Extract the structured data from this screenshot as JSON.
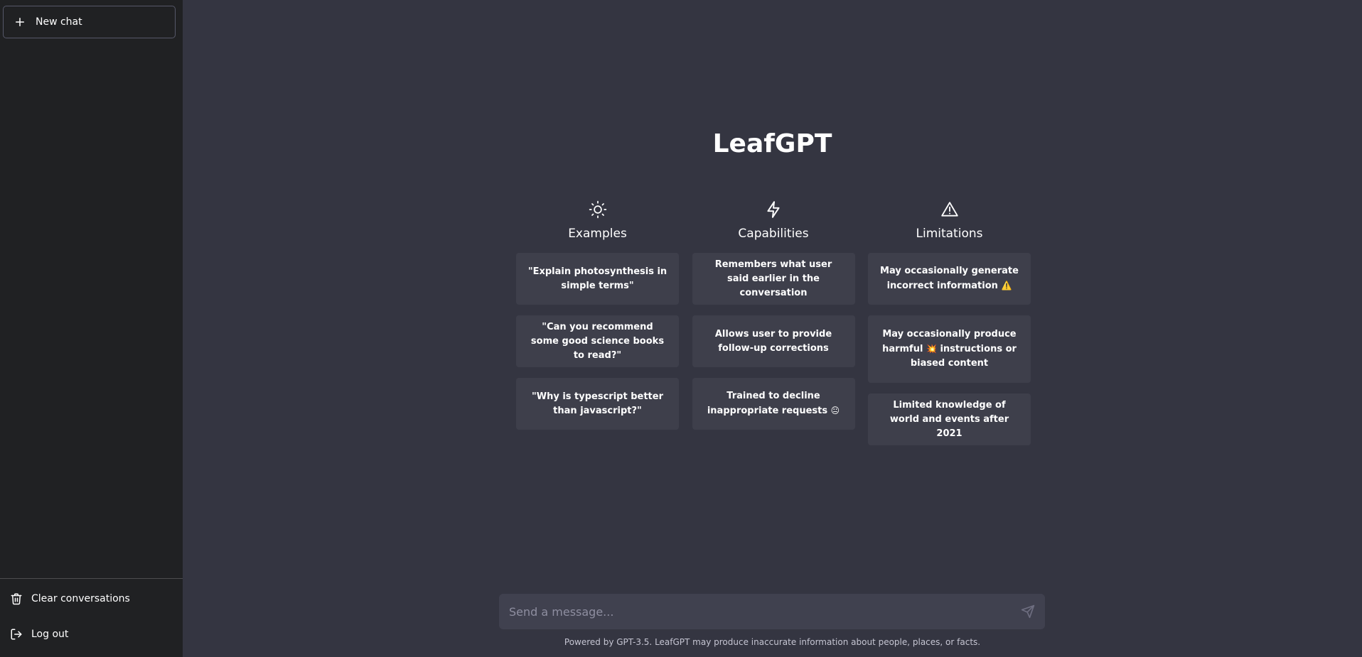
{
  "sidebar": {
    "new_chat_label": "New chat",
    "clear_label": "Clear conversations",
    "logout_label": "Log out"
  },
  "main": {
    "title": "LeafGPT",
    "columns": [
      {
        "icon": "sun-icon",
        "title": "Examples",
        "cards": [
          "\"Explain photosynthesis in simple terms\"",
          "\"Can you recommend some good science books to read?\"",
          "\"Why is typescript better than javascript?\""
        ]
      },
      {
        "icon": "lightning-icon",
        "title": "Capabilities",
        "cards": [
          "Remembers what user said earlier in the conversation",
          "Allows user to provide follow-up corrections",
          "Trained to decline inappropriate requests"
        ],
        "card3_emoji": "😐"
      },
      {
        "icon": "warning-icon",
        "title": "Limitations",
        "cards": [
          "May occasionally generate incorrect information",
          "May occasionally produce harmful",
          "instructions or biased content",
          "Limited knowledge of world and events after 2021"
        ],
        "card1_emoji": "⚠️",
        "card2_emoji": "💥"
      }
    ]
  },
  "composer": {
    "placeholder": "Send a message...",
    "footer": "Powered by GPT-3.5. LeafGPT may produce inaccurate information about people, places, or facts."
  },
  "colors": {
    "sidebar_bg": "#202123",
    "main_bg": "#343541",
    "card_bg": "#3e3f4b",
    "input_bg": "#40414f"
  }
}
